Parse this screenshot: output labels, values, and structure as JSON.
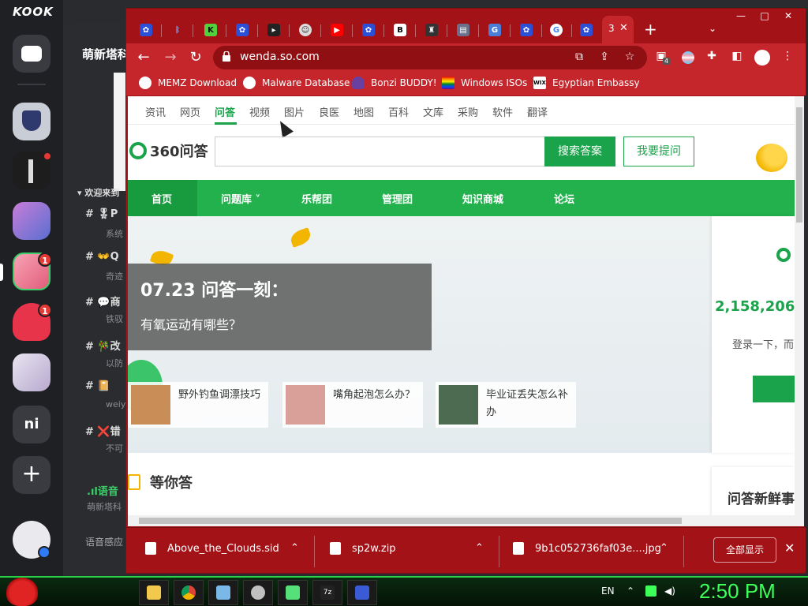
{
  "kook": {
    "logo": "KOOK",
    "server_title": "萌新塔科",
    "category": "欢迎来到",
    "channels": [
      {
        "name": "🎖P",
        "sub": "系统"
      },
      {
        "name": "👐Q",
        "sub": "奇迹"
      },
      {
        "name": "💬商",
        "sub": "铁驭"
      },
      {
        "name": "🎋改",
        "sub": "以防"
      },
      {
        "name": "📔",
        "sub": "weiy"
      },
      {
        "name": "❌错",
        "sub": "不可"
      }
    ],
    "voice_label": "语音",
    "voice_sub": "萌新塔科",
    "bottom_label": "语音感应",
    "servers": [
      {
        "name": "chat-server",
        "badge": ""
      },
      {
        "name": "server-2",
        "badge": ""
      },
      {
        "name": "server-3",
        "badge": ""
      },
      {
        "name": "server-4",
        "badge": ""
      },
      {
        "name": "server-5",
        "badge": "1"
      },
      {
        "name": "server-6",
        "badge": "1"
      },
      {
        "name": "server-7",
        "badge": ""
      },
      {
        "name": "ni",
        "badge": ""
      }
    ],
    "server_ni": "ni",
    "add": "+"
  },
  "chrome": {
    "active_tab_title": "3",
    "url": "wenda.so.com",
    "bookmarks": [
      {
        "label": "MEMZ Download",
        "color": "#ffffff"
      },
      {
        "label": "Malware Database",
        "color": "#ffffff"
      },
      {
        "label": "Bonzi BUDDY!",
        "color": "#6b3fa0"
      },
      {
        "label": "Windows ISOs",
        "color": "#ff4b4b"
      },
      {
        "label": "Egyptian Embassy",
        "color": "#ffffff"
      }
    ],
    "ext_badge": "4",
    "win_controls": {
      "min": "—",
      "max": "□",
      "close": "✕"
    }
  },
  "page": {
    "topnav": [
      "资讯",
      "网页",
      "问答",
      "视频",
      "图片",
      "良医",
      "地图",
      "百科",
      "文库",
      "采购",
      "软件",
      "翻译"
    ],
    "topnav_active": "问答",
    "logo_text": "360问答",
    "search_button": "搜索答案",
    "ask_button": "我要提问",
    "green_menu": [
      "首页",
      "问题库 ˅",
      "乐帮团",
      "管理团",
      "知识商城",
      "论坛"
    ],
    "banner_date": "07.23 问答一刻：",
    "banner_question": "有氧运动有哪些？",
    "cards": [
      {
        "title": "野外钓鱼调漂技巧"
      },
      {
        "title": "嘴角起泡怎么办？"
      },
      {
        "title": "毕业证丢失怎么补办"
      }
    ],
    "right_number": "2,158,206,",
    "right_login": "登录一下，而",
    "waiting_title": "等你答",
    "new_questions": "问答新鲜事"
  },
  "downloads": [
    {
      "name": "Above_the_Clouds.sid"
    },
    {
      "name": "sp2w.zip"
    },
    {
      "name": "9b1c052736faf03e....jpg"
    }
  ],
  "downloads_show_all": "全部显示",
  "taskbar": {
    "lang": "EN",
    "time": "2:50 PM"
  },
  "colors": {
    "chrome_frame": "#a31217",
    "chrome_toolbar": "#c4262c",
    "accent_green": "#1aa34a",
    "taskbar_green": "#3dff5a"
  }
}
